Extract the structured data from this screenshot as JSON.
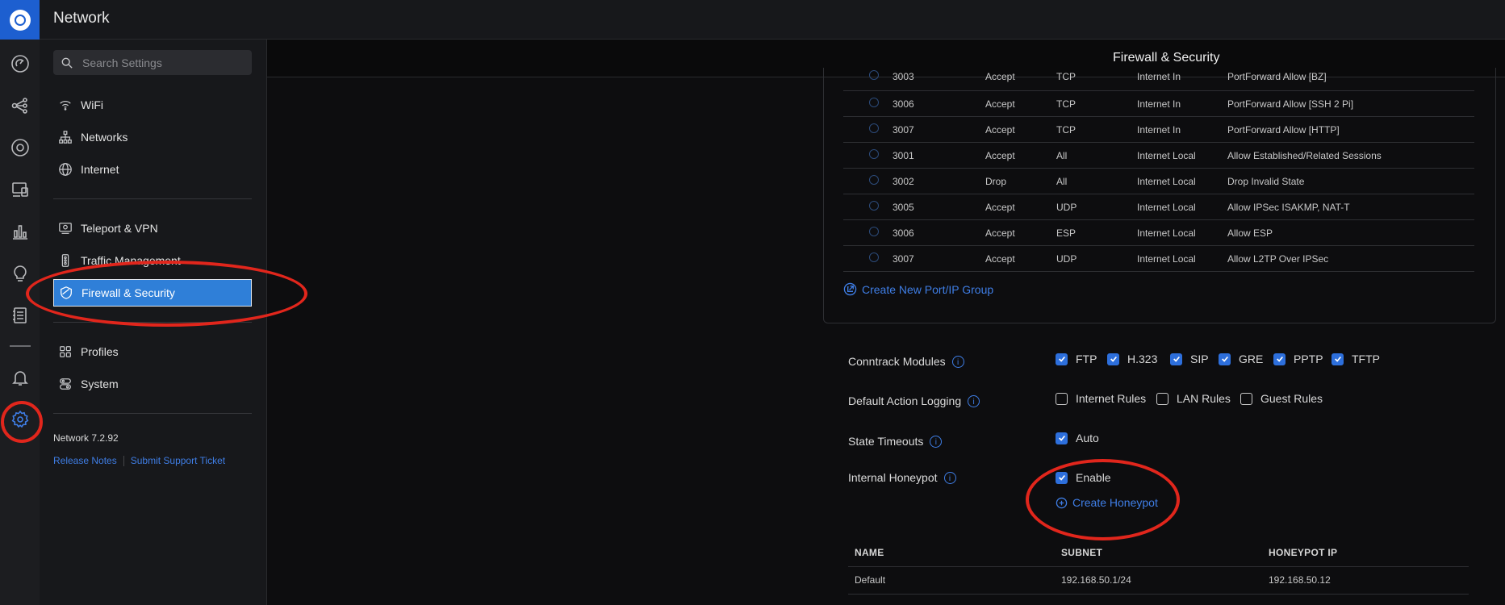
{
  "app": {
    "title": "Network"
  },
  "rail": {
    "icons": [
      "dashboard-icon",
      "topology-icon",
      "devices-icon",
      "client-devices-icon",
      "statistics-icon",
      "insights-icon",
      "logs-icon",
      "alerts-icon",
      "settings-icon"
    ]
  },
  "sidebar": {
    "search_placeholder": "Search Settings",
    "items": [
      {
        "label": "WiFi"
      },
      {
        "label": "Networks"
      },
      {
        "label": "Internet"
      },
      {
        "label": "Teleport & VPN"
      },
      {
        "label": "Traffic Management"
      },
      {
        "label": "Firewall & Security"
      },
      {
        "label": "Profiles"
      },
      {
        "label": "System"
      }
    ],
    "version": "Network 7.2.92",
    "release_notes": "Release Notes",
    "support": "Submit Support Ticket"
  },
  "main": {
    "title": "Firewall & Security",
    "rules": [
      {
        "id": "3003",
        "action": "Accept",
        "protocol": "TCP",
        "type": "Internet In",
        "name": "PortForward Allow [BZ]"
      },
      {
        "id": "3006",
        "action": "Accept",
        "protocol": "TCP",
        "type": "Internet In",
        "name": "PortForward Allow [SSH 2 Pi]"
      },
      {
        "id": "3007",
        "action": "Accept",
        "protocol": "TCP",
        "type": "Internet In",
        "name": "PortForward Allow [HTTP]"
      },
      {
        "id": "3001",
        "action": "Accept",
        "protocol": "All",
        "type": "Internet Local",
        "name": "Allow Established/Related Sessions"
      },
      {
        "id": "3002",
        "action": "Drop",
        "protocol": "All",
        "type": "Internet Local",
        "name": "Drop Invalid State"
      },
      {
        "id": "3005",
        "action": "Accept",
        "protocol": "UDP",
        "type": "Internet Local",
        "name": "Allow IPSec ISAKMP, NAT-T"
      },
      {
        "id": "3006",
        "action": "Accept",
        "protocol": "ESP",
        "type": "Internet Local",
        "name": "Allow ESP"
      },
      {
        "id": "3007",
        "action": "Accept",
        "protocol": "UDP",
        "type": "Internet Local",
        "name": "Allow L2TP Over IPSec"
      }
    ],
    "create_group": "Create New Port/IP Group",
    "conntrack": {
      "label": "Conntrack Modules",
      "options": [
        {
          "label": "FTP",
          "checked": true
        },
        {
          "label": "H.323",
          "checked": true
        },
        {
          "label": "SIP",
          "checked": true
        },
        {
          "label": "GRE",
          "checked": true
        },
        {
          "label": "PPTP",
          "checked": true
        },
        {
          "label": "TFTP",
          "checked": true
        }
      ]
    },
    "logging": {
      "label": "Default Action Logging",
      "options": [
        {
          "label": "Internet Rules",
          "checked": false
        },
        {
          "label": "LAN Rules",
          "checked": false
        },
        {
          "label": "Guest Rules",
          "checked": false
        }
      ]
    },
    "timeouts": {
      "label": "State Timeouts",
      "option": "Auto",
      "checked": true
    },
    "honeypot": {
      "label": "Internal Honeypot",
      "option": "Enable",
      "checked": true,
      "create": "Create Honeypot"
    },
    "honeypot_table": {
      "headers": [
        "NAME",
        "SUBNET",
        "HONEYPOT IP"
      ],
      "rows": [
        {
          "name": "Default",
          "subnet": "192.168.50.1/24",
          "ip": "192.168.50.12"
        }
      ]
    }
  },
  "colors": {
    "accent": "#2f7fd8",
    "link": "#3f7ee6",
    "highlight": "#e1261c"
  }
}
